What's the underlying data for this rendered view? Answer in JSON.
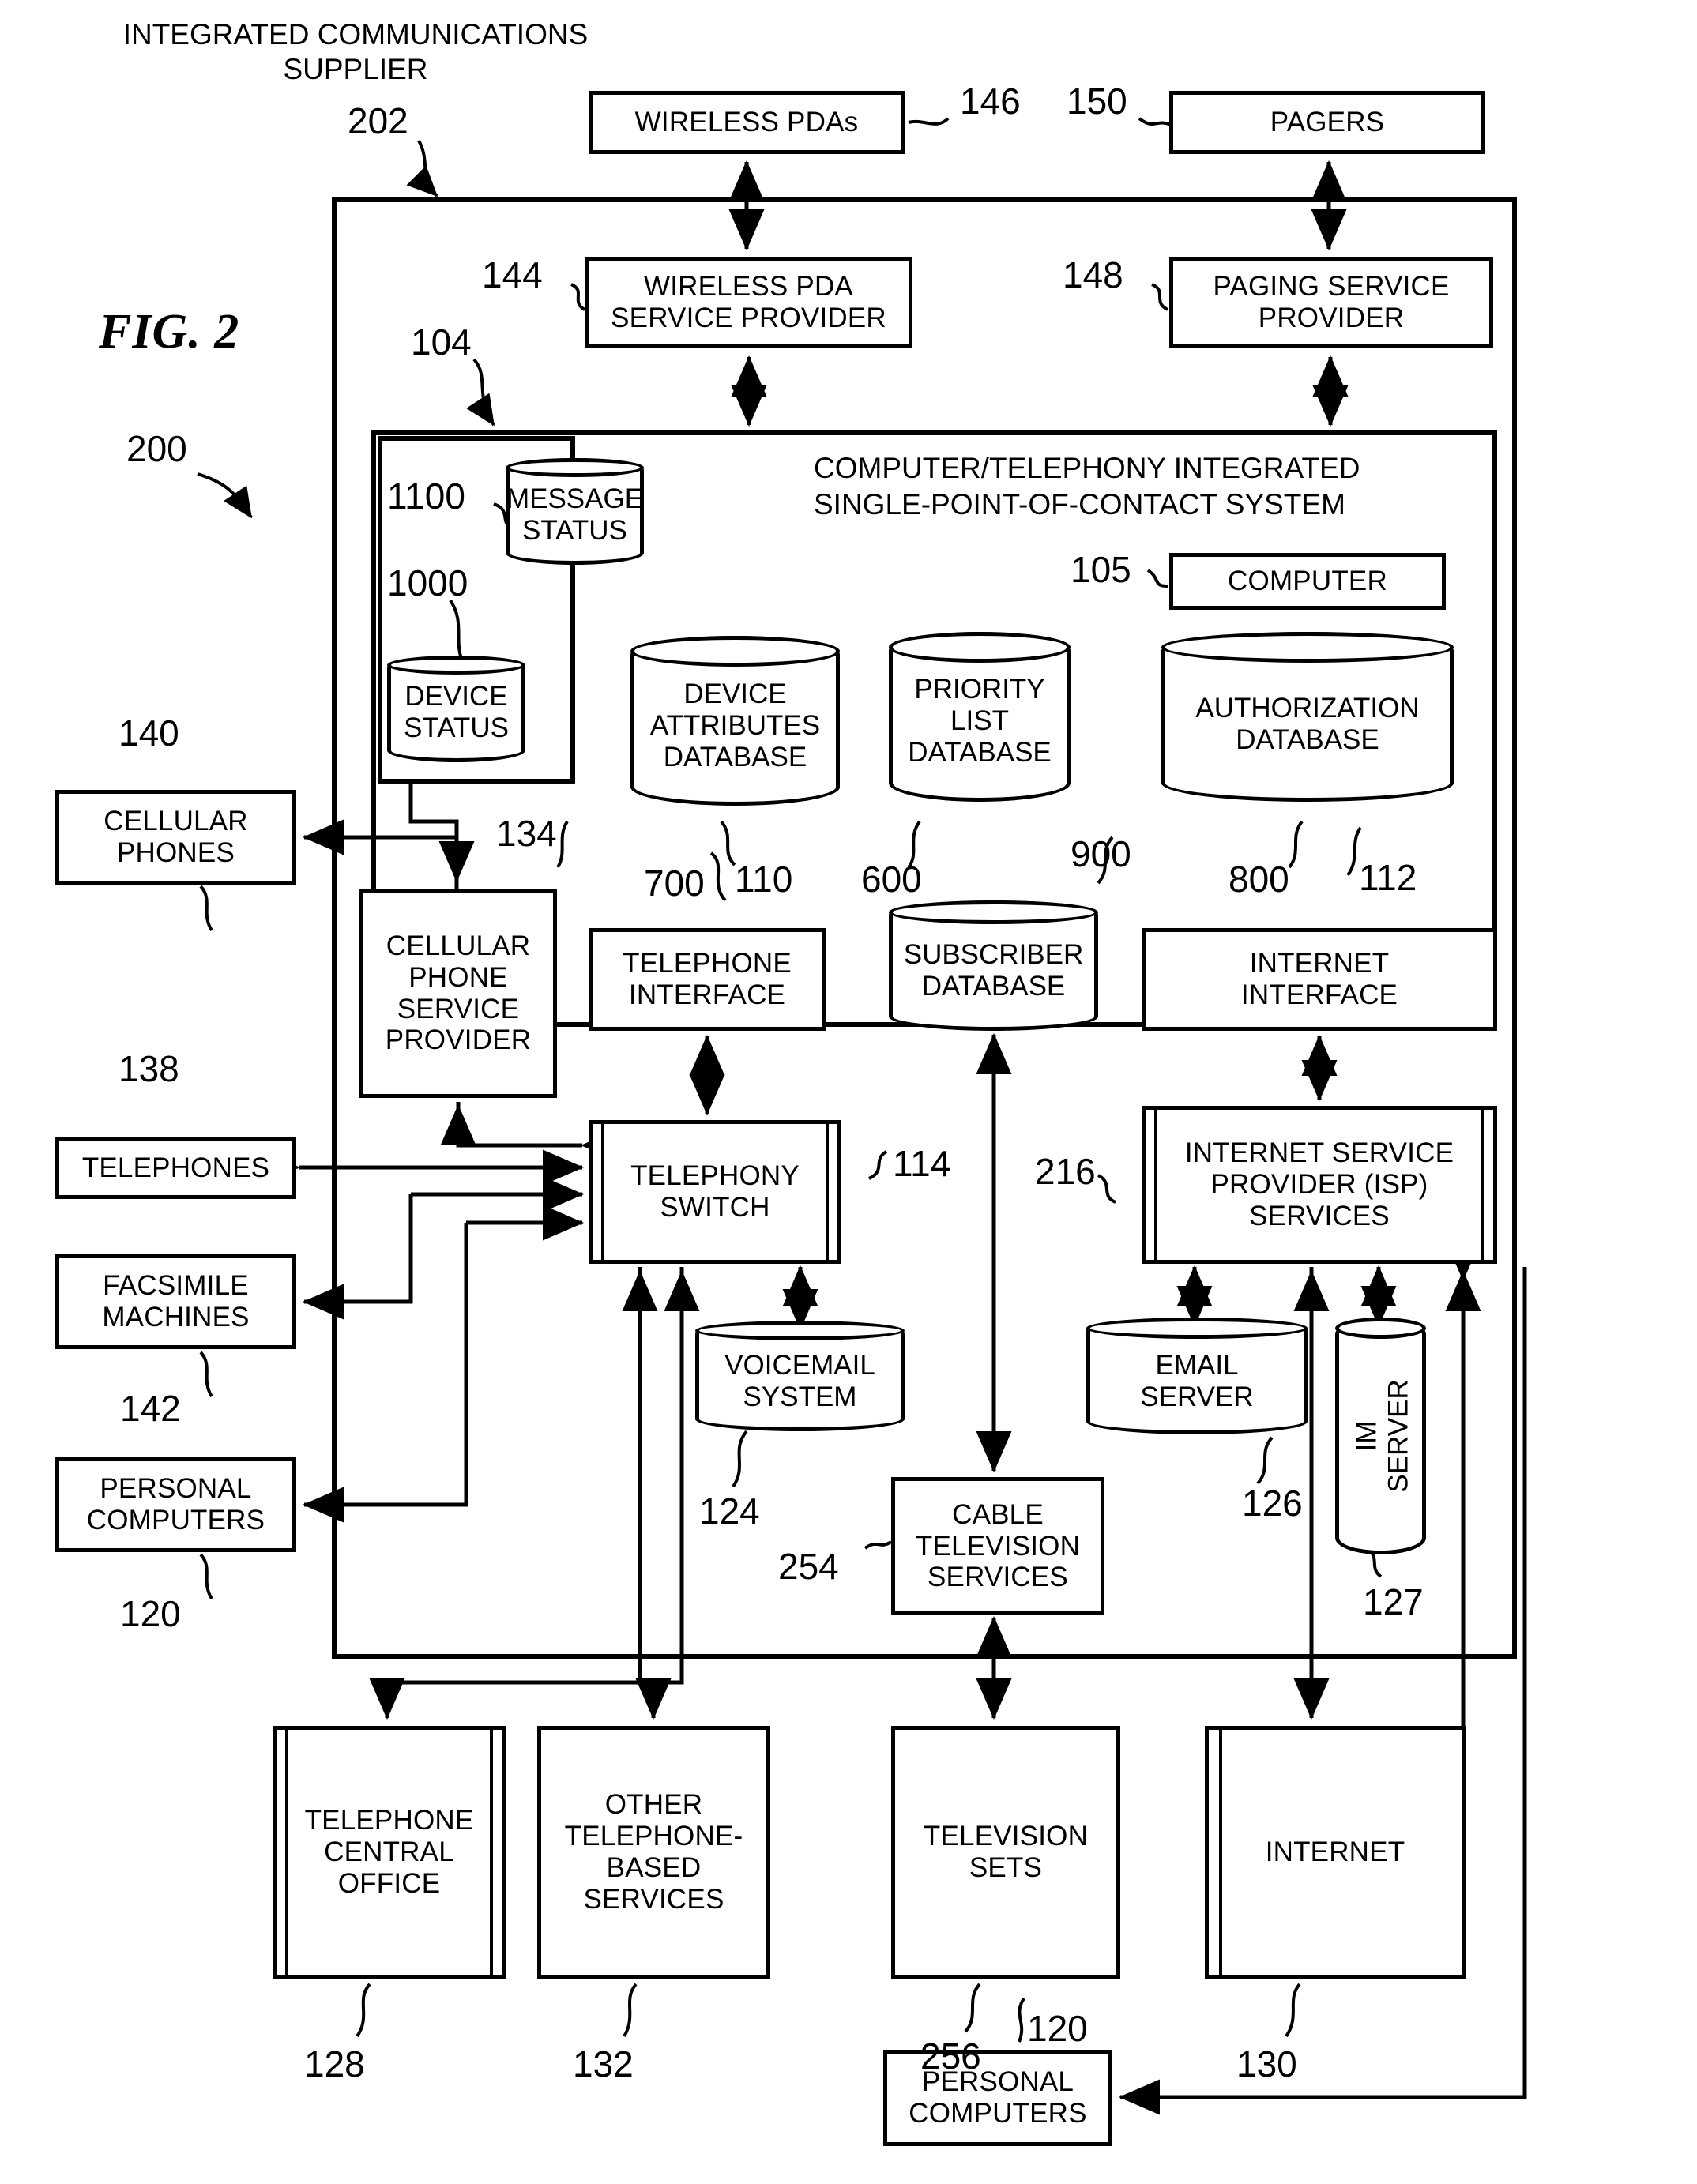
{
  "figure": {
    "label": "FIG. 2",
    "system_ref": "200",
    "supplier_caption": "INTEGRATED COMMUNICATIONS\nSUPPLIER",
    "supplier_ref": "202",
    "inner_system_title": "COMPUTER/TELEPHONY INTEGRATED\nSINGLE-POINT-OF-CONTACT SYSTEM",
    "inner_system_ref": "104"
  },
  "nodes": {
    "wireless_pdas": {
      "label": "WIRELESS PDAs",
      "ref": "146"
    },
    "pagers": {
      "label": "PAGERS",
      "ref": "150"
    },
    "wireless_pda_sp": {
      "label": "WIRELESS PDA\nSERVICE PROVIDER",
      "ref": "144"
    },
    "paging_sp": {
      "label": "PAGING SERVICE\nPROVIDER",
      "ref": "148"
    },
    "message_status": {
      "label": "MESSAGE\nSTATUS",
      "ref": "1100"
    },
    "device_status": {
      "label": "DEVICE\nSTATUS",
      "ref": "1000"
    },
    "device_attributes_db": {
      "label": "DEVICE\nATTRIBUTES\nDATABASE",
      "ref": "700"
    },
    "priority_list_db": {
      "label": "PRIORITY\nLIST\nDATABASE",
      "ref": "600"
    },
    "authorization_db": {
      "label": "AUTHORIZATION\nDATABASE",
      "ref": "800"
    },
    "computer": {
      "label": "COMPUTER",
      "ref": "105"
    },
    "telephone_interface": {
      "label": "TELEPHONE\nINTERFACE",
      "ref": "110"
    },
    "subscriber_db": {
      "label": "SUBSCRIBER\nDATABASE",
      "ref": "900"
    },
    "internet_interface": {
      "label": "INTERNET\nINTERFACE",
      "ref": "112"
    },
    "cellular_phone_sp": {
      "label": "CELLULAR\nPHONE\nSERVICE\nPROVIDER",
      "ref": "134"
    },
    "cellular_phones": {
      "label": "CELLULAR\nPHONES",
      "ref": "140"
    },
    "telephones": {
      "label": "TELEPHONES",
      "ref": "138"
    },
    "facsimile_machines": {
      "label": "FACSIMILE\nMACHINES",
      "ref": "142"
    },
    "personal_computers_left": {
      "label": "PERSONAL\nCOMPUTERS",
      "ref": "120"
    },
    "telephony_switch": {
      "label": "TELEPHONY\nSWITCH",
      "ref": "114"
    },
    "isp_services": {
      "label": "INTERNET SERVICE\nPROVIDER (ISP)\nSERVICES",
      "ref": "216"
    },
    "voicemail_system": {
      "label": "VOICEMAIL\nSYSTEM",
      "ref": "124"
    },
    "email_server": {
      "label": "EMAIL\nSERVER",
      "ref": "126"
    },
    "im_server": {
      "label": "IM SERVER",
      "ref": "127"
    },
    "cable_tv_services": {
      "label": "CABLE\nTELEVISION\nSERVICES",
      "ref": "254"
    },
    "telephone_central_office": {
      "label": "TELEPHONE\nCENTRAL\nOFFICE",
      "ref": "128"
    },
    "other_telephone_services": {
      "label": "OTHER\nTELEPHONE-\nBASED\nSERVICES",
      "ref": "132"
    },
    "television_sets": {
      "label": "TELEVISION\nSETS",
      "ref": "256"
    },
    "television_sets_ref2": {
      "ref": "120"
    },
    "internet": {
      "label": "INTERNET",
      "ref": "130"
    },
    "personal_computers_bottom": {
      "label": "PERSONAL\nCOMPUTERS"
    }
  }
}
